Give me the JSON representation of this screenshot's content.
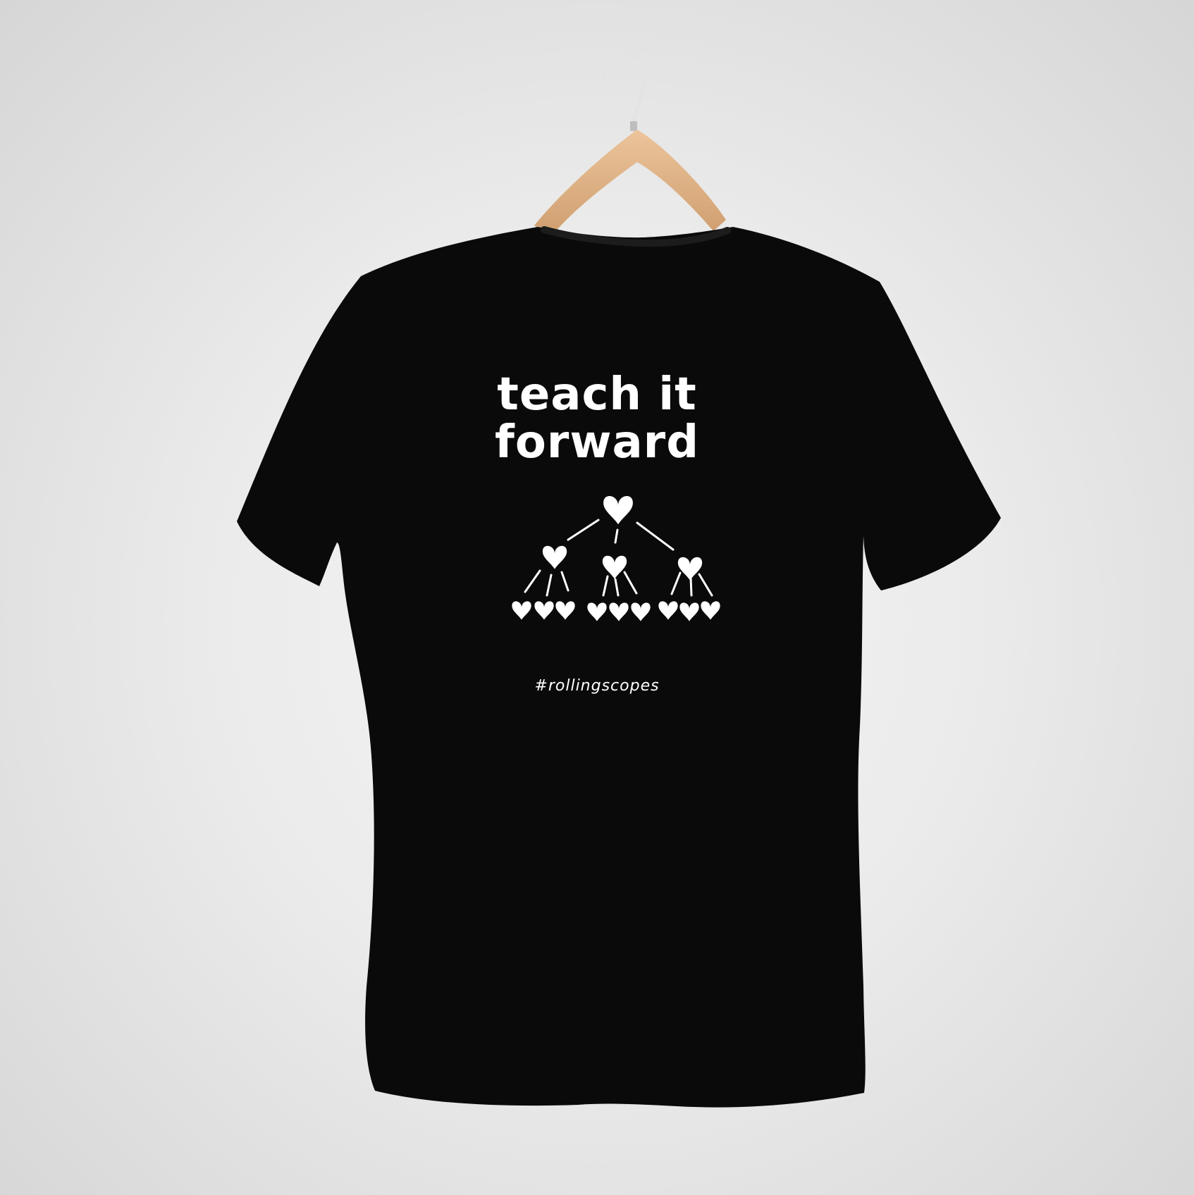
{
  "print": {
    "title_line1": "teach it",
    "title_line2": "forward",
    "hashtag": "#rollingscopes",
    "graphic": "heart-tree-icon"
  },
  "colors": {
    "background": "#ebebeb",
    "shirt": "#0a0a0a",
    "print": "#ffffff",
    "hanger_wood": "#e0b386",
    "hanger_hook": "#e6e6e6"
  }
}
